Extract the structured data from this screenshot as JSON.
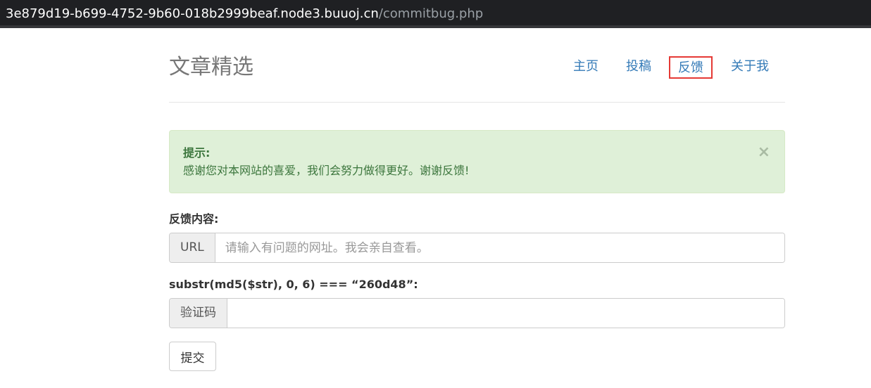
{
  "browser": {
    "url_host": "3e879d19-b699-4752-9b60-018b2999beaf.node3.buuoj.cn",
    "url_path": "/commitbug.php"
  },
  "header": {
    "brand": "文章精选",
    "nav": [
      {
        "label": "主页"
      },
      {
        "label": "投稿"
      },
      {
        "label": "反馈",
        "active": true
      },
      {
        "label": "关于我"
      }
    ]
  },
  "alert": {
    "title": "提示:",
    "message": "感谢您对本网站的喜爱，我们会努力做得更好。谢谢反馈!",
    "close": "×"
  },
  "form": {
    "feedback_label": "反馈内容:",
    "url_addon": "URL",
    "url_placeholder": "请输入有问题的网址。我会亲自查看。",
    "url_value": "",
    "captcha_label": "substr(md5($str), 0, 6) === “260d48”:",
    "captcha_addon": "验证码",
    "captcha_value": "",
    "submit_label": "提交"
  },
  "colors": {
    "link": "#337ab7",
    "active_outline": "#e53935",
    "alert_bg": "#dff0d8",
    "alert_text": "#3c763d"
  }
}
